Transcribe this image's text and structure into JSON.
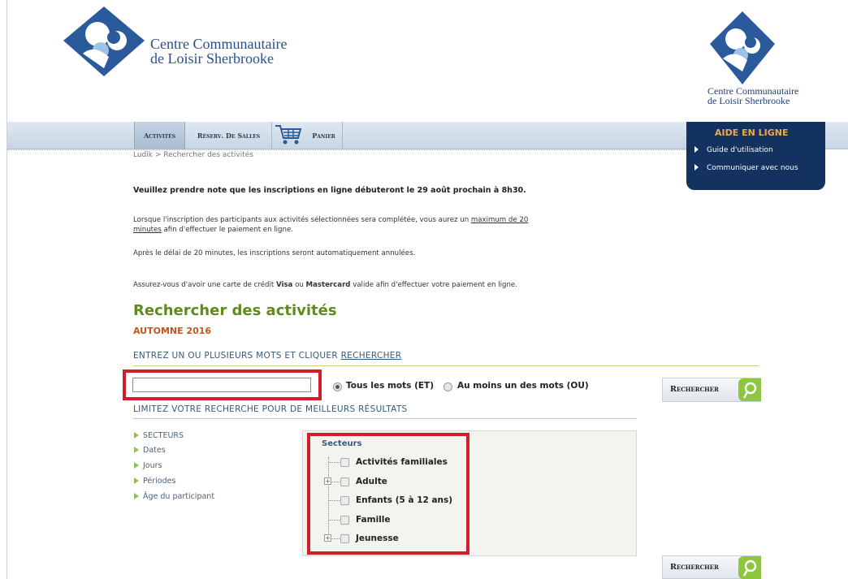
{
  "header": {
    "brand_line1": "Centre Communautaire",
    "brand_line2": "de Loisir Sherbrooke",
    "brand2_line1": "Centre Communautaire",
    "brand2_line2": "de Loisir Sherbrooke"
  },
  "nav": {
    "activites": "Activités",
    "reserv": "Réserv. De Salles",
    "panier": "Panier"
  },
  "aide": {
    "title": "AIDE EN LIGNE",
    "links": [
      "Guide d'utilisation",
      "Communiquer avec nous"
    ]
  },
  "breadcrumb": "Ludik >  Rechercher des activités",
  "notice": "Veuillez prendre note que les inscriptions en ligne débuteront le 29 août prochain à 8h30.",
  "para1_a": "Lorsque l'inscription des participants aux activités sélectionnées sera complétée, vous aurez un ",
  "para1_link1": "maximum de 20",
  "para1_link2": "minutes",
  "para1_b": " afin d'effectuer le paiement en ligne.",
  "para2": "Après le délai de 20 minutes, les inscriptions seront automatiquement annulées.",
  "para3_a": "Assurez-vous d'avoir une carte de crédit ",
  "para3_visa": "Visa",
  "para3_ou": " ou ",
  "para3_mc": "Mastercard",
  "para3_b": " valide afin d'effectuer votre paiement en ligne.",
  "main": {
    "title": "Rechercher des activités",
    "season": "AUTOMNE 2016",
    "search_head_a": "ENTREZ UN OU PLUSIEURS MOTS ET CLIQUER ",
    "search_head_link": "RECHERCHER",
    "search_value": "",
    "radio_all": "Tous les mots (ET)",
    "radio_any": "Au moins un des mots (OU)",
    "search_button": "Rechercher",
    "limit_head": "LIMITEZ VOTRE RECHERCHE POUR DE MEILLEURS RÉSULTATS",
    "filters": [
      "SECTEURS",
      "Dates",
      "Jours",
      "Périodes",
      "Âge du participant"
    ],
    "sectors_title": "Secteurs",
    "sectors": [
      "Activités familiales",
      "Adulte",
      "Enfants (5 à 12 ans)",
      "Famille",
      "Jeunesse"
    ]
  },
  "colors": {
    "accent_green": "#8dc63f",
    "title_green": "#5e8a1e",
    "navy": "#143260",
    "highlight_red": "#d21e2b"
  }
}
